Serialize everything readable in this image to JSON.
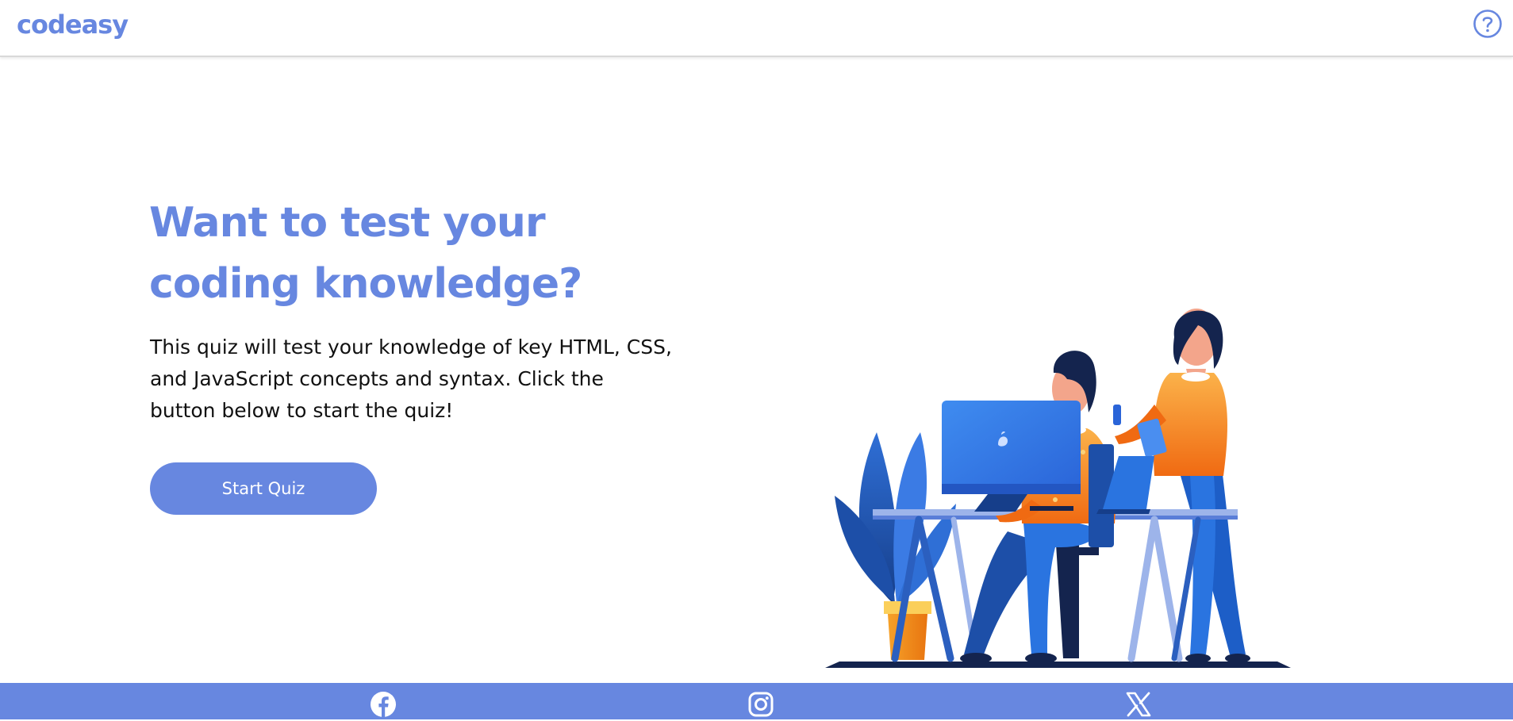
{
  "header": {
    "logo_text": "codeasy",
    "help_icon": "question-circle-icon"
  },
  "hero": {
    "headline_line1": "Want to test your",
    "headline_line2": "coding knowledge?",
    "description": "This quiz will test your knowledge of key HTML, CSS, and JavaScript concepts and syntax. Click the button below to start the quiz!",
    "button_label": "Start Quiz"
  },
  "illustration": {
    "subject": "people-at-computer-illustration"
  },
  "footer": {
    "social_links": [
      {
        "icon": "facebook-icon"
      },
      {
        "icon": "instagram-icon"
      },
      {
        "icon": "x-twitter-icon"
      }
    ]
  },
  "colors": {
    "brand": "#6787e0",
    "text": "#111111",
    "background": "#ffffff"
  }
}
